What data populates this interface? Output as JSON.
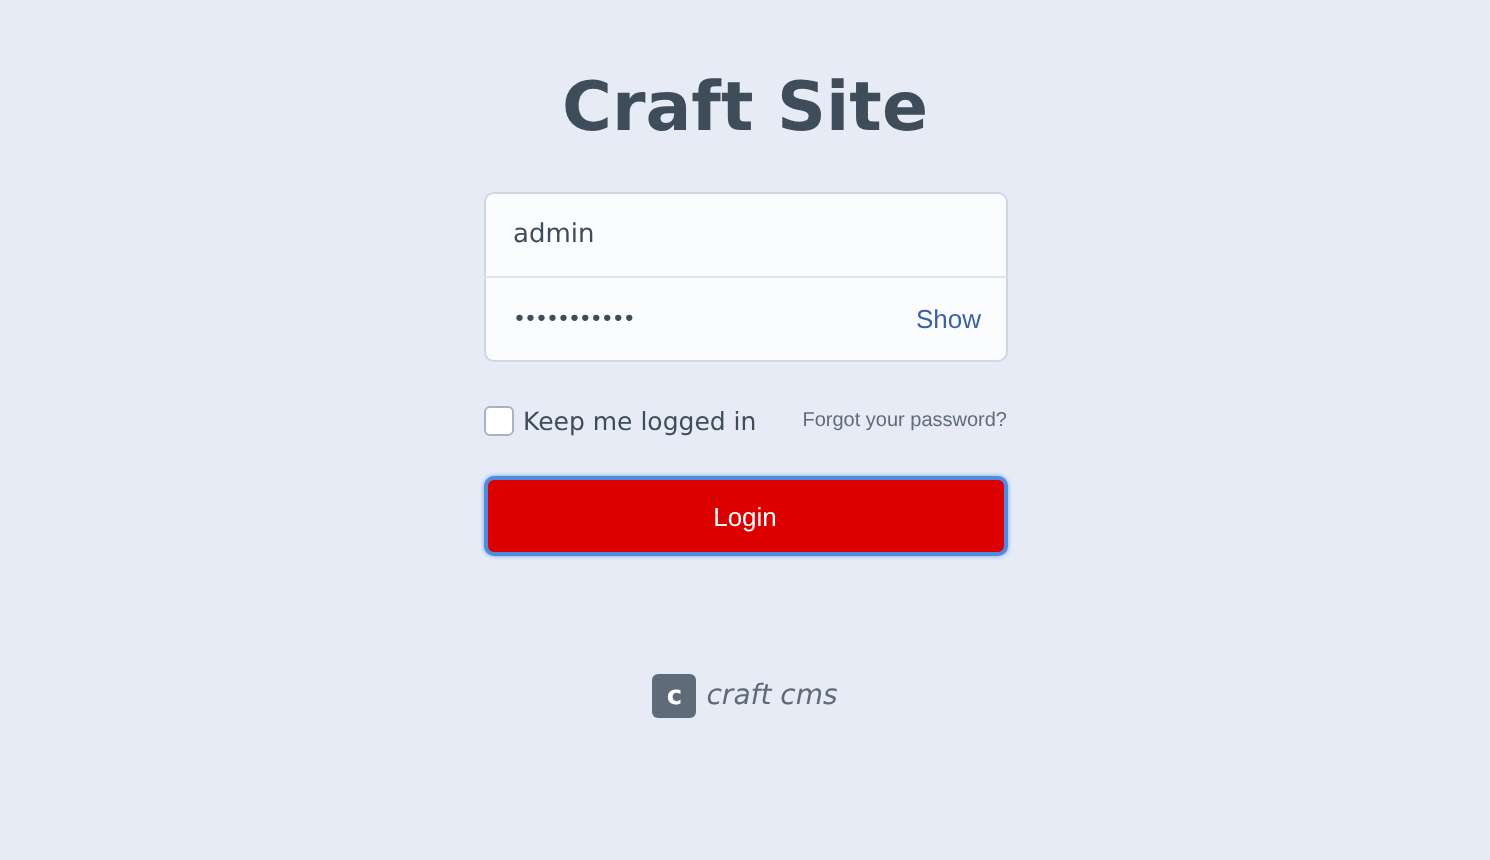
{
  "title": "Craft Site",
  "username": {
    "value": "admin"
  },
  "password": {
    "value": "•••••••••••",
    "toggle": "Show"
  },
  "remember": {
    "label": "Keep me logged in",
    "checked": false
  },
  "forgot_link": "Forgot your password?",
  "login_button": "Login",
  "footer": {
    "logo_letter": "c",
    "logo_text": "craft cms"
  }
}
